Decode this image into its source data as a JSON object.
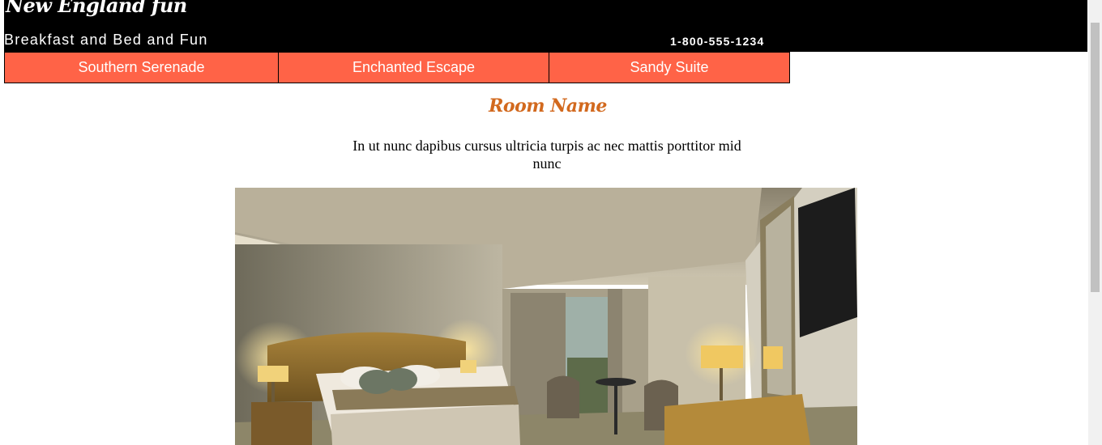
{
  "header": {
    "brand": "New England fun",
    "tagline": "Breakfast and Bed and Fun",
    "phone": "1-800-555-1234"
  },
  "nav": {
    "items": [
      {
        "label": "Southern Serenade"
      },
      {
        "label": "Enchanted Escape"
      },
      {
        "label": "Sandy Suite"
      }
    ]
  },
  "main": {
    "room_name": "Room Name",
    "description": "In ut nunc dapibus cursus ultricia turpis ac nec mattis porttitor mid nunc"
  },
  "colors": {
    "header_bg": "#000000",
    "nav_bg": "#ff6347",
    "room_name": "#d2691e"
  }
}
